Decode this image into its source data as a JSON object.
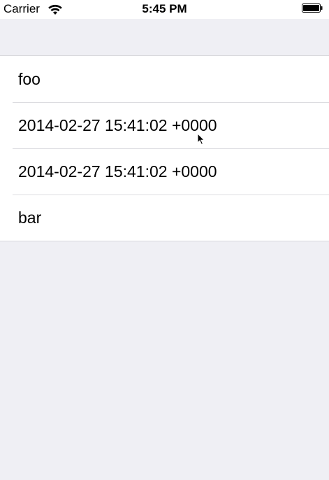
{
  "status_bar": {
    "carrier": "Carrier",
    "time": "5:45 PM",
    "wifi_icon": "wifi-icon",
    "battery_icon": "battery-icon",
    "battery_level": 1.0
  },
  "table": {
    "rows": [
      {
        "label": "foo"
      },
      {
        "label": "2014-02-27 15:41:02 +0000"
      },
      {
        "label": "2014-02-27 15:41:02 +0000"
      },
      {
        "label": "bar"
      }
    ]
  },
  "colors": {
    "background": "#efeff4",
    "cell_background": "#ffffff",
    "separator": "#dcdce0",
    "text": "#000000"
  },
  "cursor_icon": "mouse-pointer-icon"
}
